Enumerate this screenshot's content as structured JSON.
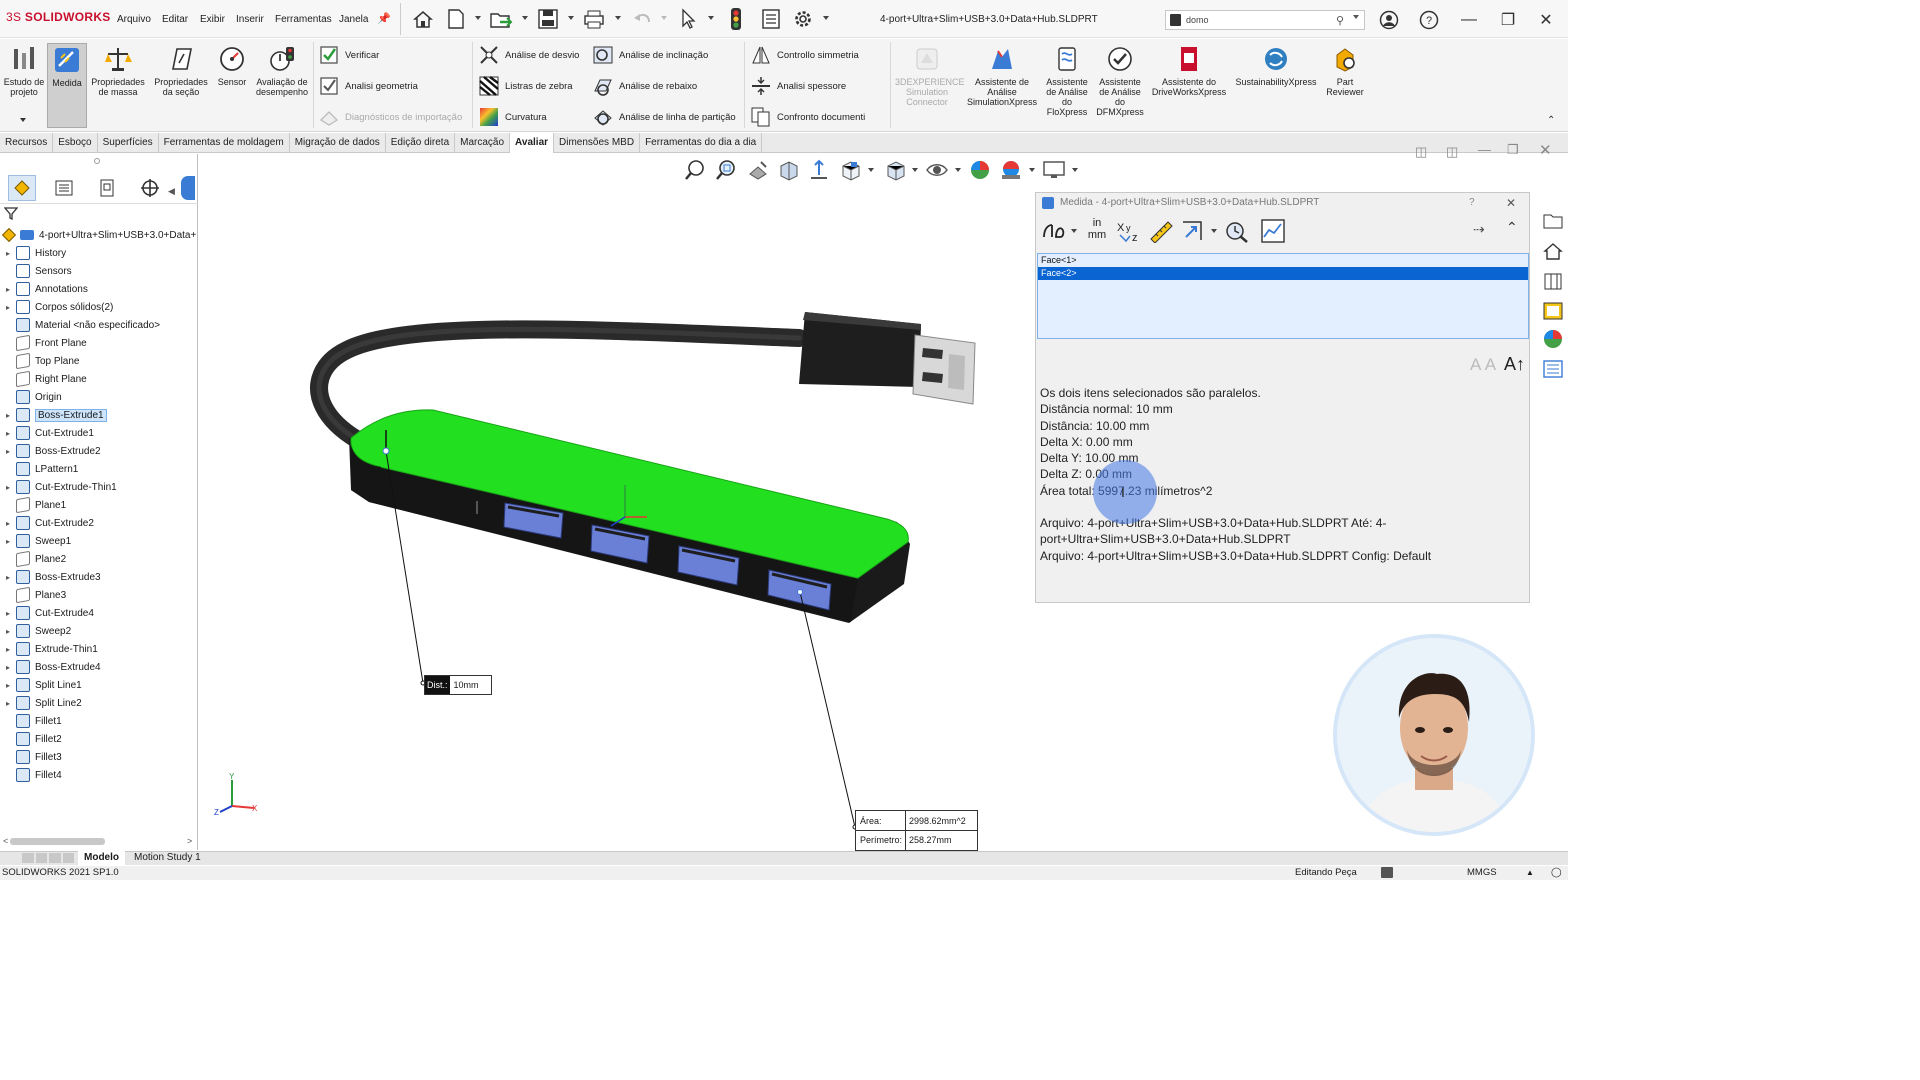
{
  "app": {
    "logo_prefix": "3S",
    "logo_name": "SOLIDWORKS",
    "document_title": "4-port+Ultra+Slim+USB+3.0+Data+Hub.SLDPRT",
    "search_value": "domo"
  },
  "menu": [
    "Arquivo",
    "Editar",
    "Exibir",
    "Inserir",
    "Ferramentas",
    "Janela"
  ],
  "ribbon": {
    "big_buttons": [
      {
        "label": "Estudo de projeto",
        "icon": "design-study-icon"
      },
      {
        "label": "Medida",
        "icon": "measure-icon",
        "active": true
      },
      {
        "label": "Propriedades de massa",
        "icon": "mass-properties-icon"
      },
      {
        "label": "Propriedades da seção",
        "icon": "section-properties-icon"
      },
      {
        "label": "Sensor",
        "icon": "sensor-icon"
      },
      {
        "label": "Avaliação de desempenho",
        "icon": "performance-evaluation-icon"
      }
    ],
    "col1": [
      "Verificar",
      "Analisi geometria",
      "Diagnósticos de importação"
    ],
    "col2": [
      "Análise de desvio",
      "Listras de zebra",
      "Curvatura"
    ],
    "col3": [
      "Análise de inclinação",
      "Análise de rebaixo",
      "Análise de linha de partição"
    ],
    "col4": [
      "Controllo simmetria",
      "Analisi spessore",
      "Confronto documenti"
    ],
    "addins": [
      {
        "label": "3DEXPERIENCE Simulation Connector",
        "disabled": true
      },
      {
        "label": "Assistente de Análise SimulationXpress"
      },
      {
        "label": "Assistente de Análise do FloXpress"
      },
      {
        "label": "Assistente de Análise do DFMXpress"
      },
      {
        "label": "Assistente do DriveWorksXpress"
      },
      {
        "label": "SustainabilityXpress"
      },
      {
        "label": "Part Reviewer"
      }
    ]
  },
  "tabs": [
    "Recursos",
    "Esboço",
    "Superfícies",
    "Ferramentas de moldagem",
    "Migração de dados",
    "Edição direta",
    "Marcação",
    "Avaliar",
    "Dimensões MBD",
    "Ferramentas do dia a dia"
  ],
  "active_tab": "Avaliar",
  "tree": {
    "root": "4-port+Ultra+Slim+USB+3.0+Data+",
    "items": [
      {
        "label": "History",
        "expand": true
      },
      {
        "label": "Sensors",
        "expand": false
      },
      {
        "label": "Annotations",
        "expand": true
      },
      {
        "label": "Corpos sólidos(2)",
        "expand": true
      },
      {
        "label": "Material <não especificado>",
        "expand": false
      },
      {
        "label": "Front Plane",
        "expand": false
      },
      {
        "label": "Top Plane",
        "expand": false
      },
      {
        "label": "Right Plane",
        "expand": false
      },
      {
        "label": "Origin",
        "expand": false
      },
      {
        "label": "Boss-Extrude1",
        "expand": true,
        "selected": true
      },
      {
        "label": "Cut-Extrude1",
        "expand": true
      },
      {
        "label": "Boss-Extrude2",
        "expand": true
      },
      {
        "label": "LPattern1",
        "expand": false
      },
      {
        "label": "Cut-Extrude-Thin1",
        "expand": true
      },
      {
        "label": "Plane1",
        "expand": false
      },
      {
        "label": "Cut-Extrude2",
        "expand": true
      },
      {
        "label": "Sweep1",
        "expand": true
      },
      {
        "label": "Plane2",
        "expand": false
      },
      {
        "label": "Boss-Extrude3",
        "expand": true
      },
      {
        "label": "Plane3",
        "expand": false
      },
      {
        "label": "Cut-Extrude4",
        "expand": true
      },
      {
        "label": "Sweep2",
        "expand": true
      },
      {
        "label": "Extrude-Thin1",
        "expand": true
      },
      {
        "label": "Boss-Extrude4",
        "expand": true
      },
      {
        "label": "Split Line1",
        "expand": true
      },
      {
        "label": "Split Line2",
        "expand": true
      },
      {
        "label": "Fillet1",
        "expand": false
      },
      {
        "label": "Fillet2",
        "expand": false
      },
      {
        "label": "Fillet3",
        "expand": false
      },
      {
        "label": "Fillet4",
        "expand": false
      }
    ]
  },
  "measure": {
    "title": "Medida - 4-port+Ultra+Slim+USB+3.0+Data+Hub.SLDPRT",
    "units_top": "in",
    "units_bottom": "mm",
    "selections": [
      "Face<1>",
      "Face<2>"
    ],
    "lines": [
      "Os dois itens selecionados são paralelos.",
      "Distância normal: 10 mm",
      "Distância: 10.00 mm",
      "Delta X: 0.00 mm",
      "Delta Y: 10.00 mm",
      "Delta Z: 0.00 mm",
      "Área total: 5997.23 milímetros^2"
    ],
    "file_line": "Arquivo: 4-port+Ultra+Slim+USB+3.0+Data+Hub.SLDPRT Até: 4-port+Ultra+Slim+USB+3.0+Data+Hub.SLDPRT",
    "config_line": "Arquivo: 4-port+Ultra+Slim+USB+3.0+Data+Hub.SLDPRT Config: Default"
  },
  "callouts": {
    "dist_label": "Dist.:",
    "dist_value": "10mm",
    "area_label": "Área:",
    "area_value": "2998.62mm^2",
    "perimeter_label": "Perímetro:",
    "perimeter_value": "258.27mm"
  },
  "triad": {
    "x": "X",
    "y": "Y",
    "z": "Z"
  },
  "bottom_tabs": [
    "Modelo",
    "Motion Study 1"
  ],
  "status": {
    "version": "SOLIDWORKS 2021 SP1.0",
    "mode": "Editando Peça",
    "units": "MMGS"
  },
  "colors": {
    "face_highlight": "#22e01f",
    "brand_red": "#c8102e",
    "selection_blue": "#0a64d2",
    "port_blue": "#6a7fd6"
  }
}
